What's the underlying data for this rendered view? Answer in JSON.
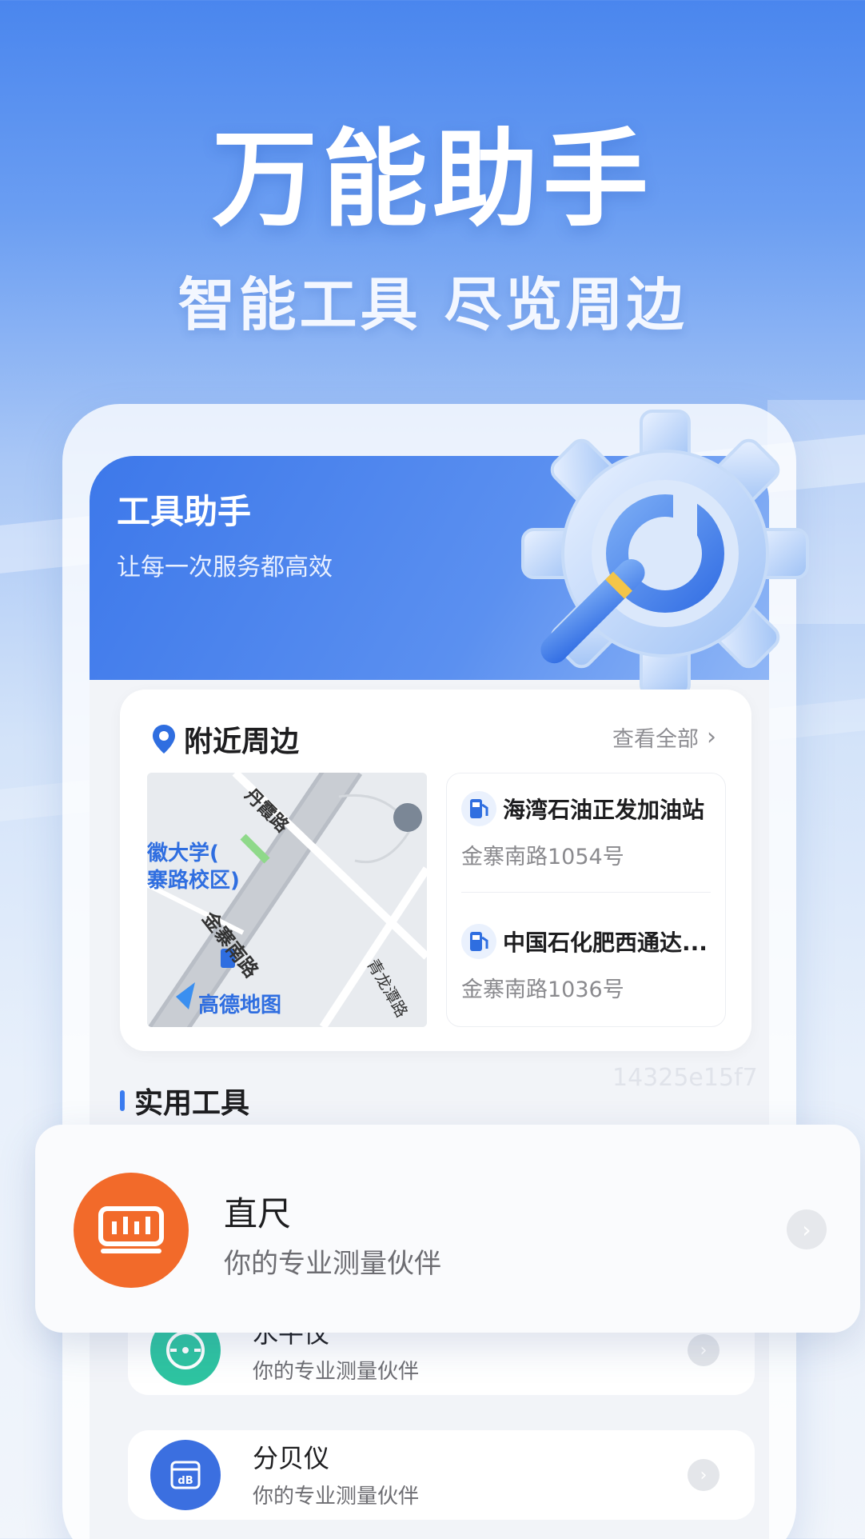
{
  "hero": {
    "title": "万能助手",
    "subtitle": "智能工具 尽览周边"
  },
  "app_header": {
    "title": "工具助手",
    "subtitle": "让每一次服务都高效"
  },
  "nearby": {
    "title": "附近周边",
    "view_all": "查看全部",
    "map": {
      "labels": [
        "丹霞路",
        "徽大学(",
        "寨路校区)",
        "金寨南路",
        "青龙潭路"
      ],
      "brand": "高德地图"
    },
    "stations": [
      {
        "name": "海湾石油正发加油站",
        "address": "金寨南路1054号"
      },
      {
        "name": "中国石化肥西通达...",
        "address": "金寨南路1036号"
      }
    ]
  },
  "tools": {
    "title": "实用工具",
    "watermark": "14325e15f7",
    "items": [
      {
        "name": "直尺",
        "desc": "你的专业测量伙伴",
        "icon": "ruler-icon",
        "color": "#f26a2a"
      },
      {
        "name": "水平仪",
        "desc": "你的专业测量伙伴",
        "icon": "level-icon",
        "color": "#2ec4a1"
      },
      {
        "name": "分贝仪",
        "desc": "你的专业测量伙伴",
        "icon": "decibel-icon",
        "color": "#3b6fe0"
      }
    ]
  },
  "colors": {
    "accent": "#3b7cf0",
    "ruler": "#f26a2a",
    "level": "#2ec4a1",
    "decibel": "#3b6fe0"
  }
}
